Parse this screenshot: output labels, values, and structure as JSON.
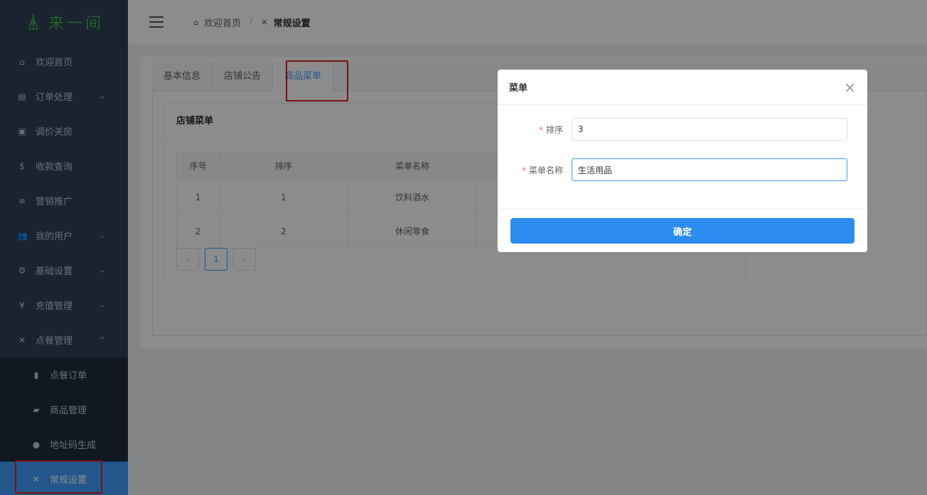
{
  "logo": {
    "text": "来一间",
    "color": "#3bb34a"
  },
  "sidebar": {
    "items": [
      {
        "label": "欢迎首页",
        "icon": "home-icon"
      },
      {
        "label": "订单处理",
        "icon": "document-icon",
        "has_arrow": true
      },
      {
        "label": "调价关房",
        "icon": "calendar-icon"
      },
      {
        "label": "收款查询",
        "icon": "dollar-icon"
      },
      {
        "label": "营销推广",
        "icon": "filter-icon"
      },
      {
        "label": "我的用户",
        "icon": "users-icon",
        "has_arrow": true
      },
      {
        "label": "基础设置",
        "icon": "gear-icon",
        "has_arrow": true
      },
      {
        "label": "充值管理",
        "icon": "yen-icon",
        "has_arrow": true
      },
      {
        "label": "点餐管理",
        "icon": "utensils-icon",
        "expanded": true
      }
    ],
    "subitems": [
      {
        "label": "点餐订单",
        "icon": "receipt-icon"
      },
      {
        "label": "商品管理",
        "icon": "briefcase-icon"
      },
      {
        "label": "地址码生成",
        "icon": "location-pin-icon"
      },
      {
        "label": "常规设置",
        "icon": "tools-icon",
        "active": true
      }
    ]
  },
  "header": {
    "breadcrumb": {
      "home": "欢迎首页",
      "current": "常规设置"
    }
  },
  "tabs": [
    {
      "label": "基本信息"
    },
    {
      "label": "店铺公告"
    },
    {
      "label": "商品菜单",
      "active": true
    }
  ],
  "card": {
    "title": "店铺菜单",
    "table": {
      "headers": [
        "序号",
        "排序",
        "菜单名称"
      ],
      "rows": [
        [
          "1",
          "1",
          "饮料酒水"
        ],
        [
          "2",
          "2",
          "休闲零食"
        ]
      ]
    },
    "pager": {
      "prev": "‹",
      "current": "1",
      "next": "›"
    }
  },
  "modal": {
    "title": "菜单",
    "fields": {
      "sort": {
        "label": "排序",
        "value": "3"
      },
      "name": {
        "label": "菜单名称",
        "value": "生活用品"
      }
    },
    "confirm": "确定"
  },
  "colors": {
    "sidebar_bg": "#304156",
    "primary": "#409eff",
    "button": "#2d8cf0",
    "highlight_box": "#e02020"
  }
}
